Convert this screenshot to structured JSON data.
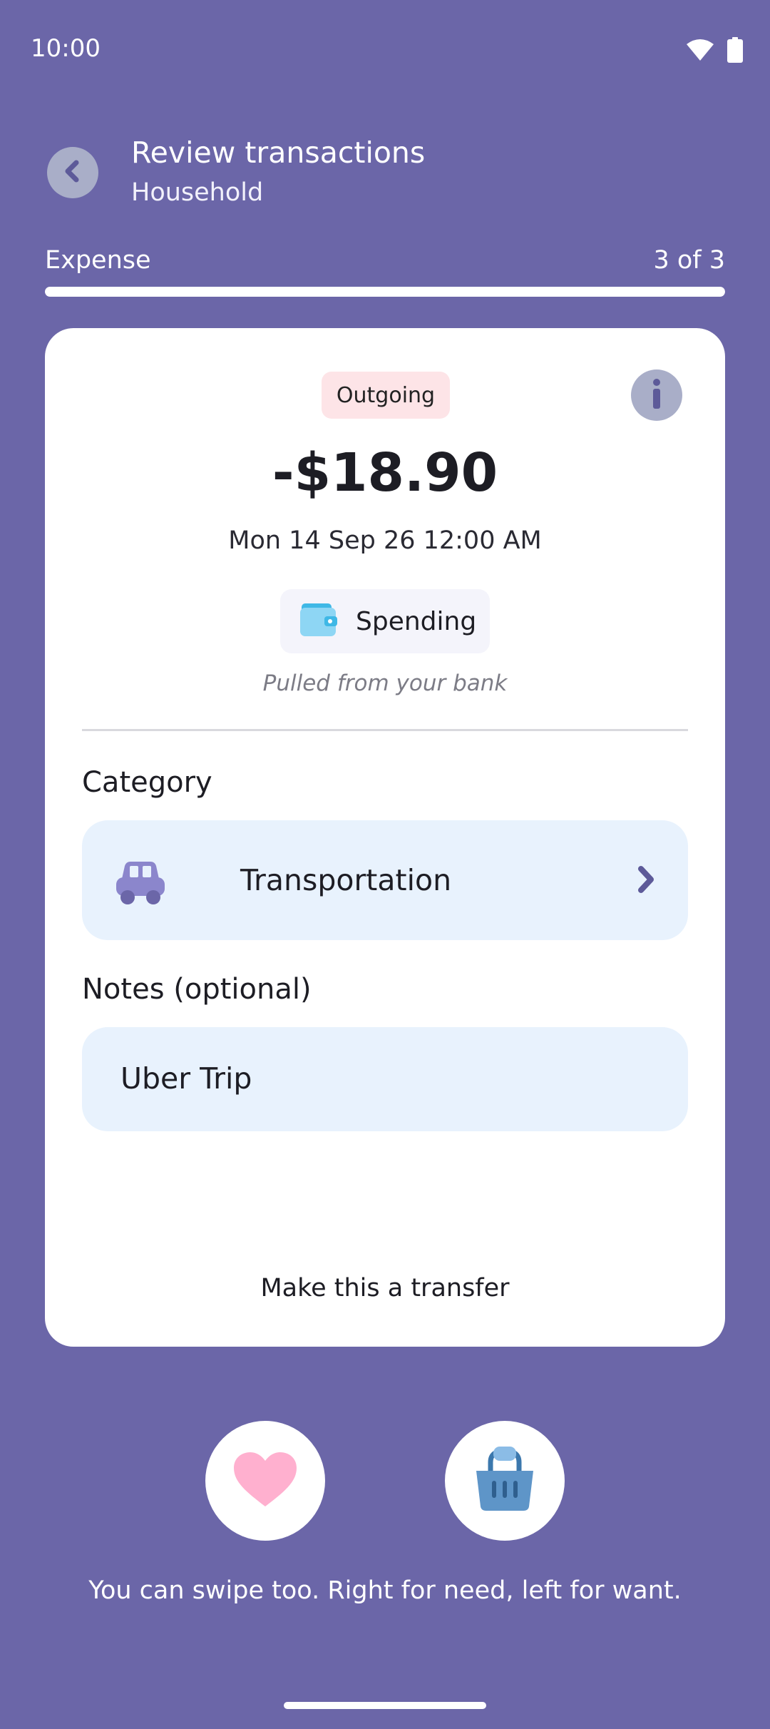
{
  "status_bar": {
    "time": "10:00",
    "wifi_icon": "wifi-icon",
    "battery_icon": "battery-icon"
  },
  "header": {
    "title": "Review transactions",
    "subtitle": "Household",
    "back_icon": "chevron-left-icon"
  },
  "progress": {
    "label": "Expense",
    "count_text": "3 of 3",
    "current": 3,
    "total": 3
  },
  "transaction": {
    "direction_badge": "Outgoing",
    "amount": "-$18.90",
    "date": "Mon 14 Sep 26 12:00 AM",
    "account": {
      "label": "Spending",
      "icon": "wallet-icon"
    },
    "source_note": "Pulled from your bank",
    "info_icon": "info-icon"
  },
  "category": {
    "section_label": "Category",
    "selected": "Transportation",
    "icon": "car-icon",
    "chevron_icon": "chevron-right-icon"
  },
  "notes": {
    "section_label": "Notes (optional)",
    "value": "Uber Trip"
  },
  "transfer_link": "Make this a transfer",
  "actions": {
    "want_icon": "heart-icon",
    "need_icon": "basket-icon",
    "hint": "You can swipe too. Right for need, left for want."
  },
  "colors": {
    "background": "#6B66A8",
    "card": "#FFFFFF",
    "badge_bg": "#FDE4E7",
    "field_bg": "#E8F2FD",
    "accent": "#6B66A8",
    "heart": "#FFB0CF",
    "basket": "#5E95C8"
  }
}
